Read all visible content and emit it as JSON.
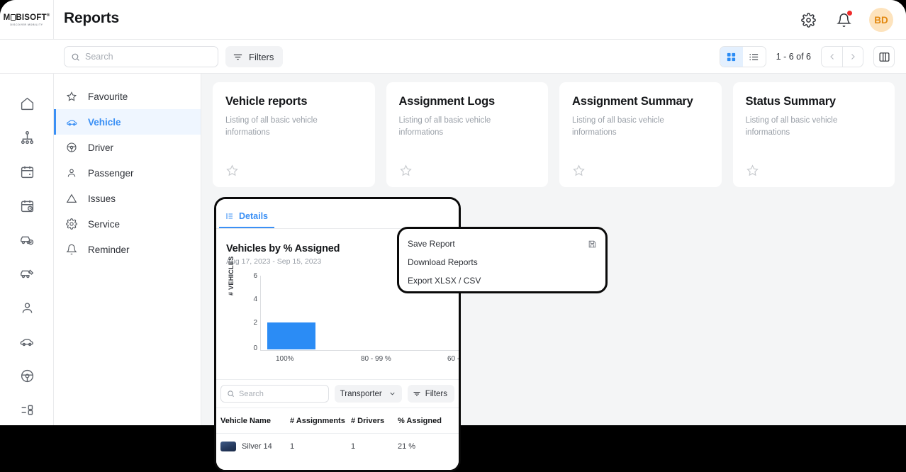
{
  "brand": {
    "name_part1": "M",
    "name_part2": "BISOFT",
    "trademark": "®",
    "tagline": "DISCOVER MOBILITY"
  },
  "header": {
    "title": "Reports",
    "settings_icon": "gear-icon",
    "notifications_icon": "bell-icon",
    "avatar_initials": "BD"
  },
  "toolbar": {
    "search_placeholder": "Search",
    "search_value": "",
    "filters_label": "Filters",
    "count_label": "1 - 6 of 6",
    "grid_view_icon": "grid-view-icon",
    "list_view_icon": "list-view-icon",
    "prev_label": "‹",
    "next_label": "›",
    "panel_toggle_icon": "panel-toggle-icon"
  },
  "rail": {
    "items": [
      {
        "icon": "home-icon",
        "name": "home"
      },
      {
        "icon": "org-chart-icon",
        "name": "organization"
      },
      {
        "icon": "calendar-icon",
        "name": "calendar"
      },
      {
        "icon": "calendar-clock-icon",
        "name": "schedule"
      },
      {
        "icon": "car-check-icon",
        "name": "vehicle-check"
      },
      {
        "icon": "car-key-icon",
        "name": "vehicle-key"
      },
      {
        "icon": "person-icon",
        "name": "person"
      },
      {
        "icon": "car-icon",
        "name": "vehicle"
      },
      {
        "icon": "steering-wheel-icon",
        "name": "driver"
      },
      {
        "icon": "list-settings-icon",
        "name": "settings-list"
      }
    ]
  },
  "sidebar": {
    "items": [
      {
        "label": "Favourite",
        "icon": "star-icon",
        "active": false
      },
      {
        "label": "Vehicle",
        "icon": "car-icon",
        "active": true
      },
      {
        "label": "Driver",
        "icon": "steering-wheel-icon",
        "active": false
      },
      {
        "label": "Passenger",
        "icon": "person-icon",
        "active": false
      },
      {
        "label": "Issues",
        "icon": "warning-triangle-icon",
        "active": false
      },
      {
        "label": "Service",
        "icon": "gear-icon",
        "active": false
      },
      {
        "label": "Reminder",
        "icon": "bell-icon",
        "active": false
      }
    ]
  },
  "cards": [
    {
      "title": "Vehicle reports",
      "desc": "Listing of all basic vehicle informations",
      "favourite_icon": "star-icon"
    },
    {
      "title": "Assignment Logs",
      "desc": "Listing of all basic vehicle informations",
      "favourite_icon": "star-icon"
    },
    {
      "title": "Assignment Summary",
      "desc": "Listing of all basic vehicle informations",
      "favourite_icon": "star-icon"
    },
    {
      "title": "Status Summary",
      "desc": "Listing of all basic vehicle informations",
      "favourite_icon": "star-icon"
    }
  ],
  "details": {
    "tab_label": "Details",
    "tab_icon": "details-list-icon",
    "table_search_placeholder": "Search",
    "table_search_value": "",
    "transporter_label": "Transporter",
    "filters_label": "Filters",
    "columns": [
      "Vehicle Name",
      "# Assignments",
      "# Drivers",
      "% Assigned"
    ],
    "rows": [
      {
        "vehicle": "Silver 14",
        "assignments": "1",
        "drivers": "1",
        "assigned": "21 %"
      }
    ]
  },
  "menu": {
    "items": [
      {
        "label": "Save Report",
        "icon": "save-icon"
      },
      {
        "label": "Download Reports",
        "icon": ""
      },
      {
        "label": "Export XLSX / CSV",
        "icon": ""
      }
    ]
  },
  "colors": {
    "accent": "#3b90f5",
    "bar": "#2b8cf5",
    "avatar_bg": "#fde3bd",
    "avatar_fg": "#e2880f",
    "notification_dot": "#ef2b2b",
    "highlight_border": "#0a0a0a"
  },
  "chart_data": {
    "type": "bar",
    "title": "Vehicles by % Assigned",
    "subtitle": "Aug 17, 2023 - Sep 15, 2023",
    "xlabel": "",
    "ylabel": "# VEHICLES",
    "categories": [
      "100%",
      "80 - 99 %",
      "60 - "
    ],
    "values": [
      2.2,
      0,
      0
    ],
    "yticks": [
      "0",
      "2",
      "4",
      "6"
    ],
    "ylim": [
      0,
      6
    ],
    "grid": false,
    "legend": false
  }
}
